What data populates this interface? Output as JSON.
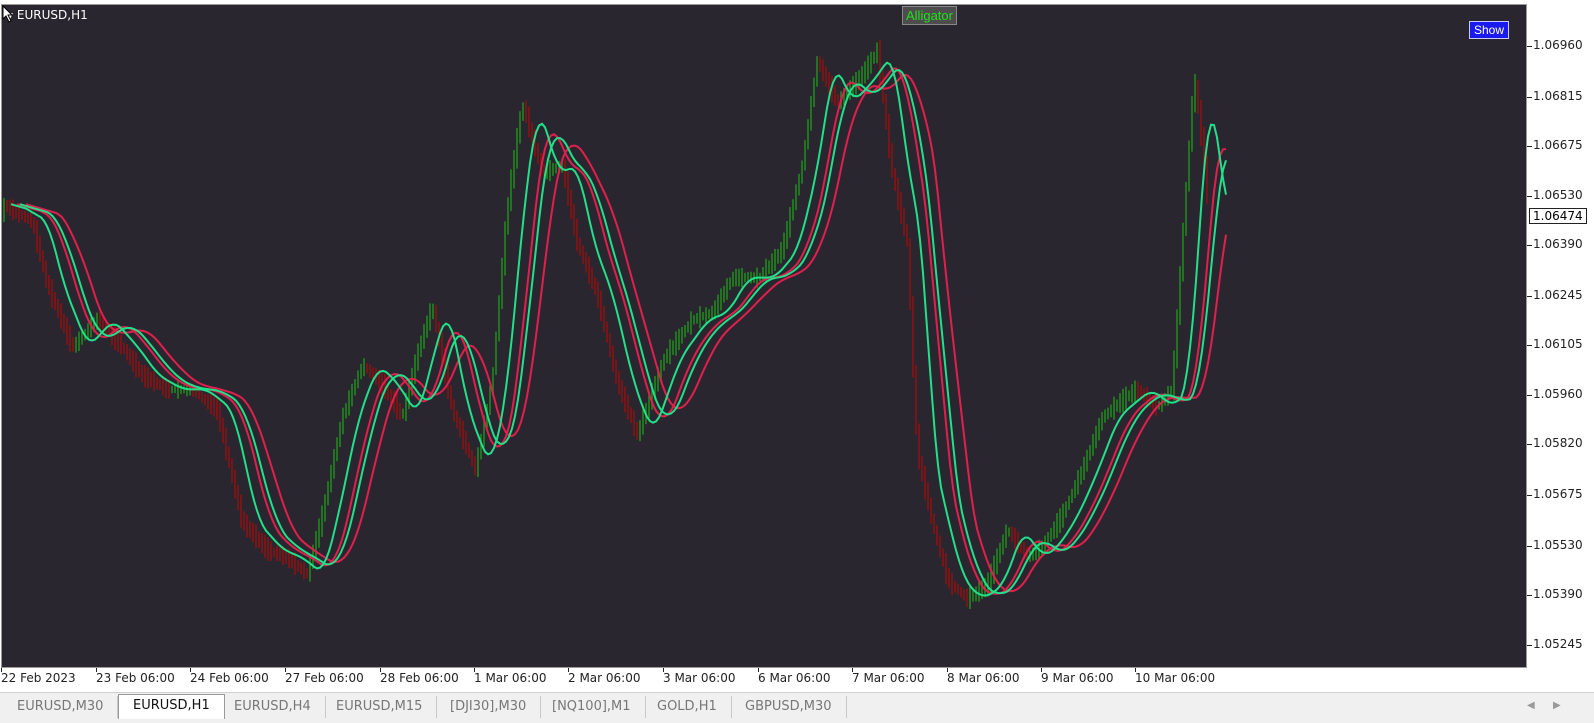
{
  "chart": {
    "symbol_title": "EURUSD,H1",
    "indicator_label": "Alligator",
    "show_button": "Show",
    "colors": {
      "background": "#2a2630",
      "bull_candle": "#1f8f1f",
      "bear_candle": "#8f1010",
      "alligator_jaw": "#e0204c",
      "alligator_teeth": "#e0204c",
      "alligator_lips": "#22e08a"
    },
    "price_levels": [
      "1.06960",
      "1.06815",
      "1.06675",
      "1.06530",
      "1.06390",
      "1.06245",
      "1.06105",
      "1.05960",
      "1.05820",
      "1.05675",
      "1.05530",
      "1.05390",
      "1.05245"
    ],
    "current_price": "1.06474",
    "time_labels": [
      "22 Feb 2023",
      "23 Feb 06:00",
      "24 Feb 06:00",
      "27 Feb 06:00",
      "28 Feb 06:00",
      "1 Mar 06:00",
      "2 Mar 06:00",
      "3 Mar 06:00",
      "6 Mar 06:00",
      "7 Mar 06:00",
      "8 Mar 06:00",
      "9 Mar 06:00",
      "10 Mar 06:00"
    ]
  },
  "tabs": [
    {
      "label": "EURUSD,M30",
      "active": false
    },
    {
      "label": "EURUSD,H1",
      "active": true
    },
    {
      "label": "EURUSD,H4",
      "active": false
    },
    {
      "label": "EURUSD,M15",
      "active": false
    },
    {
      "label": "[DJI30],M30",
      "active": false
    },
    {
      "label": "[NQ100],M1",
      "active": false
    },
    {
      "label": "GOLD,H1",
      "active": false
    },
    {
      "label": "GBPUSD,M30",
      "active": false
    }
  ],
  "tab_scroll": {
    "left": "◀",
    "right": "▶"
  },
  "chart_data": {
    "type": "line",
    "title": "",
    "ylim": [
      1.0518,
      1.0708
    ],
    "x": [
      "22 Feb 2023",
      "23 Feb 06:00",
      "24 Feb 06:00",
      "27 Feb 06:00",
      "28 Feb 06:00",
      "1 Mar 06:00",
      "2 Mar 06:00",
      "3 Mar 06:00",
      "6 Mar 06:00",
      "7 Mar 06:00",
      "8 Mar 06:00",
      "9 Mar 06:00",
      "10 Mar 06:00"
    ],
    "series": [
      {
        "values": [
          1.0658,
          1.063,
          1.0608,
          1.056,
          1.0592,
          1.0578,
          1.0655,
          1.0612,
          1.0625,
          1.068,
          1.055,
          1.0548,
          1.06
        ]
      },
      {
        "values": [
          1.0652,
          1.0622,
          1.06,
          1.0552,
          1.0578,
          1.0585,
          1.0648,
          1.061,
          1.0615,
          1.069,
          1.054,
          1.0552,
          1.0585
        ]
      },
      {
        "values": [
          1.065,
          1.0628,
          1.0595,
          1.055,
          1.059,
          1.0594,
          1.0656,
          1.0613,
          1.0618,
          1.0683,
          1.0538,
          1.055,
          1.0578
        ]
      }
    ]
  }
}
